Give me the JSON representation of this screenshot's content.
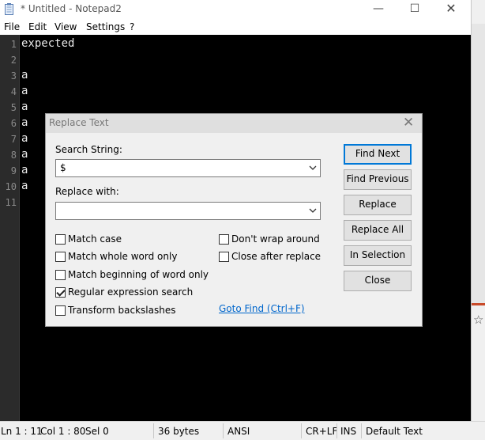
{
  "window": {
    "title": "* Untitled - Notepad2",
    "minimize_glyph": "—",
    "maximize_glyph": "☐",
    "close_glyph": "✕"
  },
  "menu": [
    "File",
    "Edit",
    "View",
    "Settings",
    "?"
  ],
  "editor": {
    "line_numbers": [
      "1",
      "2",
      "3",
      "4",
      "5",
      "6",
      "7",
      "8",
      "9",
      "10",
      "11"
    ],
    "lines": [
      "expected",
      "",
      "a",
      "a",
      "a",
      "a",
      "a",
      "a",
      "a",
      "a",
      ""
    ]
  },
  "status": {
    "position": "Ln 1 : 11",
    "col": "Col 1 : 80",
    "sel": "Sel 0",
    "size": "36 bytes",
    "encoding": "ANSI",
    "eol": "CR+LF",
    "mode": "INS",
    "scheme": "Default Text"
  },
  "dialog": {
    "title": "Replace Text",
    "close_glyph": "✕",
    "search_label": "Search String:",
    "search_value": "$",
    "replace_label": "Replace with:",
    "replace_value": "",
    "options": {
      "match_case": {
        "label": "Match case",
        "checked": false
      },
      "whole_word": {
        "label": "Match whole word only",
        "checked": false
      },
      "word_begin": {
        "label": "Match beginning of word only",
        "checked": false
      },
      "regex": {
        "label": "Regular expression search",
        "checked": true
      },
      "backslash": {
        "label": "Transform backslashes",
        "checked": false
      },
      "no_wrap": {
        "label": "Don't wrap around",
        "checked": false
      },
      "close_after": {
        "label": "Close after replace",
        "checked": false
      }
    },
    "goto_link": "Goto Find (Ctrl+F)",
    "buttons": {
      "find_next": "Find Next",
      "find_previous": "Find Previous",
      "replace": "Replace",
      "replace_all": "Replace All",
      "in_selection": "In Selection",
      "close": "Close"
    }
  },
  "behind_window": {
    "icon": "star-icon",
    "glyph": "☆"
  },
  "colors": {
    "editor_bg": "#000000",
    "gutter_bg": "#2b2b2b",
    "link": "#0066cc",
    "accent": "#0078d7"
  }
}
